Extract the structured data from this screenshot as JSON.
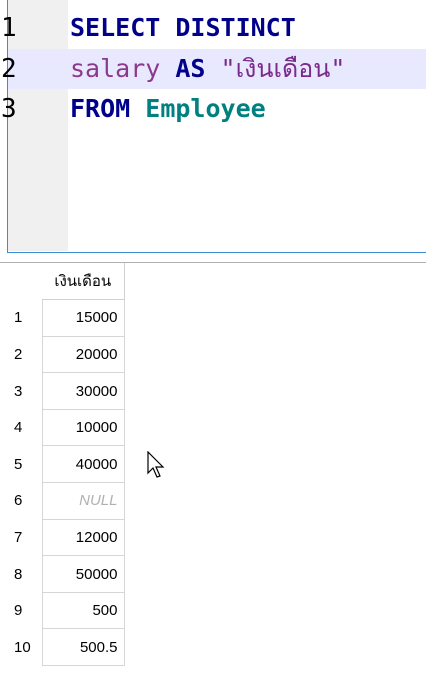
{
  "editor": {
    "lines": [
      {
        "num": "1",
        "tokens": [
          {
            "t": "SELECT DISTINCT",
            "c": "kw"
          }
        ]
      },
      {
        "num": "2",
        "tokens": [
          {
            "t": "salary",
            "c": "col"
          },
          {
            "t": " ",
            "c": ""
          },
          {
            "t": "AS",
            "c": "kw"
          },
          {
            "t": " ",
            "c": ""
          },
          {
            "t": "\"เงินเดือน\"",
            "c": "str"
          }
        ]
      },
      {
        "num": "3",
        "tokens": [
          {
            "t": "FROM",
            "c": "kw"
          },
          {
            "t": " ",
            "c": ""
          },
          {
            "t": "Employee",
            "c": "tbl"
          }
        ]
      }
    ]
  },
  "results": {
    "column_header": "เงินเดือน",
    "rows": [
      {
        "num": "1",
        "value": "15000"
      },
      {
        "num": "2",
        "value": "20000"
      },
      {
        "num": "3",
        "value": "30000"
      },
      {
        "num": "4",
        "value": "10000"
      },
      {
        "num": "5",
        "value": "40000"
      },
      {
        "num": "6",
        "value": "NULL",
        "null": true
      },
      {
        "num": "7",
        "value": "12000"
      },
      {
        "num": "8",
        "value": "50000"
      },
      {
        "num": "9",
        "value": "500"
      },
      {
        "num": "10",
        "value": "500.5"
      }
    ]
  },
  "icons": {
    "cursor": "mouse-pointer-icon"
  },
  "colors": {
    "keyword": "#00008b",
    "column": "#8b3a8b",
    "table": "#008080",
    "null": "#b0b0b0",
    "current_line": "#e8e8ff"
  }
}
